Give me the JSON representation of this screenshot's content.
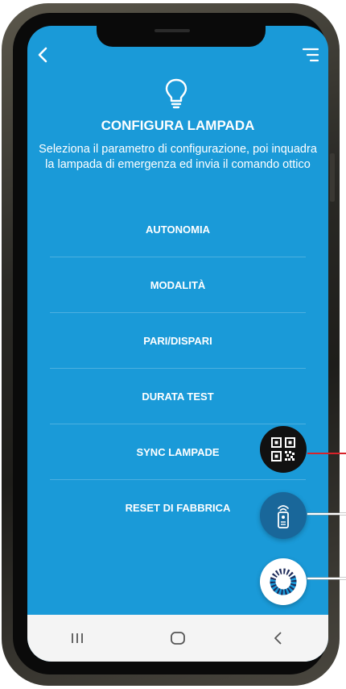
{
  "header": {
    "back_icon": "chevron-left-icon",
    "menu_icon": "menu-icon"
  },
  "page": {
    "icon": "lightbulb-icon",
    "title": "CONFIGURA LAMPADA",
    "description": "Seleziona il parametro di configurazione, poi inquadra la lampada di emergenza ed invia il comando ottico"
  },
  "options": [
    {
      "label": "AUTONOMIA"
    },
    {
      "label": "MODALITÀ"
    },
    {
      "label": "PARI/DISPARI"
    },
    {
      "label": "DURATA TEST"
    },
    {
      "label": "SYNC LAMPADE"
    },
    {
      "label": "RESET DI FABBRICA"
    }
  ],
  "fabs": {
    "qr": {
      "icon": "qr-code-icon"
    },
    "remote": {
      "icon": "remote-control-icon"
    },
    "sync": {
      "icon": "sync-ring-icon"
    }
  },
  "navbar": {
    "recent_icon": "recent-apps-icon",
    "home_icon": "home-icon",
    "back_icon": "back-icon"
  },
  "colors": {
    "screen_bg": "#1a9ad8",
    "accent_red": "#d8232a",
    "fab_remote": "#19679a"
  }
}
